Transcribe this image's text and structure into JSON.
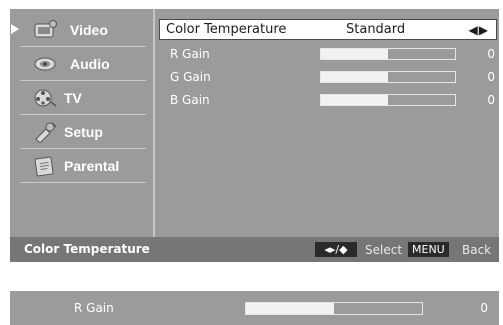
{
  "sidebar": {
    "items": [
      {
        "label": "Video",
        "icon": "video-film-icon",
        "selected": true
      },
      {
        "label": "Audio",
        "icon": "speaker-icon",
        "selected": false
      },
      {
        "label": "TV",
        "icon": "film-reel-icon",
        "selected": false
      },
      {
        "label": "Setup",
        "icon": "setup-tools-icon",
        "selected": false
      },
      {
        "label": "Parental",
        "icon": "parental-book-icon",
        "selected": false
      }
    ]
  },
  "main": {
    "selected_row": {
      "label": "Color Temperature",
      "value": "Standard",
      "arrows": "◀▶"
    },
    "rows": [
      {
        "label": "R Gain",
        "value": "0",
        "level": 0.5
      },
      {
        "label": "G Gain",
        "value": "0",
        "level": 0.5
      },
      {
        "label": "B Gain",
        "value": "0",
        "level": 0.5
      }
    ]
  },
  "footer": {
    "title": "Color Temperature",
    "nav_key": "◂▸/◆",
    "select_label": "Select",
    "menu_key": "MENU",
    "back_label": "Back"
  },
  "strip": {
    "label": "R Gain",
    "value": "0",
    "level": 0.5
  },
  "colors": {
    "panel": "#9b9b9b",
    "footer": "#767676",
    "highlight": "#ffffff",
    "key": "#2a2a2a"
  }
}
